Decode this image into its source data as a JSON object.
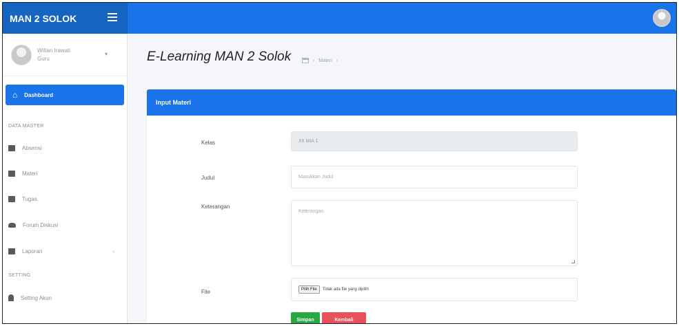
{
  "brand": "MAN 2 SOLOK",
  "user": {
    "name": "Wiltan Irawati",
    "role": "Guru"
  },
  "nav": {
    "dashboard": "Dashboard",
    "master_header": "DATA MASTER",
    "absensi": "Absensi",
    "materi": "Materi",
    "tugas": "Tugas",
    "forum": "Forum Diskusi",
    "laporan": "Laporan",
    "setting_header": "SETTING",
    "setting_akun": "Setting Akun"
  },
  "header": {
    "title": "E-Learning MAN 2 Solok",
    "breadcrumb": "Materi"
  },
  "card": {
    "title": "Input Materi"
  },
  "form": {
    "kelas_label": "Kelas",
    "kelas_value": "XII MIA 1",
    "judul_label": "Judul",
    "judul_placeholder": "Masukkan Judul",
    "keterangan_label": "Keterangan",
    "keterangan_placeholder": "Keterangan",
    "file_label": "File",
    "file_button": "Pilih File",
    "file_status": "Tidak ada file yang dipilih",
    "save_label": "Simpan",
    "cancel_label": "Kembali"
  },
  "colors": {
    "primary": "#1a73e8",
    "brand_dark": "#1565c0",
    "success": "#28a745",
    "danger": "#e8505b"
  }
}
